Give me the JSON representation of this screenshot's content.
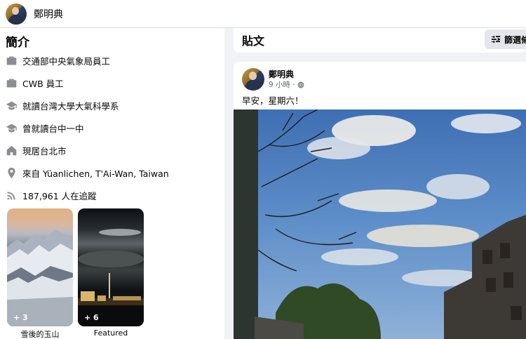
{
  "header": {
    "name": "鄭明典"
  },
  "intro": {
    "title": "簡介",
    "items": [
      {
        "icon": "briefcase-icon",
        "text": "交通部中央氣象局員工"
      },
      {
        "icon": "briefcase-icon",
        "text": "CWB 員工"
      },
      {
        "icon": "graduation-cap-icon",
        "text": "就讀台灣大學大氣科學系"
      },
      {
        "icon": "graduation-cap-icon",
        "text": "曾就讀台中一中"
      },
      {
        "icon": "home-icon",
        "text": "現居台北市"
      },
      {
        "icon": "location-pin-icon",
        "text": "來自 Yüanlichen, T'Ai-Wan, Taiwan"
      },
      {
        "icon": "rss-icon",
        "text": "187,961 人在追蹤"
      }
    ]
  },
  "featured": [
    {
      "count": "+ 3",
      "label": "雪後的玉山"
    },
    {
      "count": "+ 6",
      "label": "Featured"
    }
  ],
  "posts": {
    "title": "貼文",
    "filter_label": "篩選條"
  },
  "post": {
    "author": "鄭明典",
    "time": "9 小時 ·",
    "privacy_icon": "globe-icon",
    "text": "早安，星期六！"
  }
}
